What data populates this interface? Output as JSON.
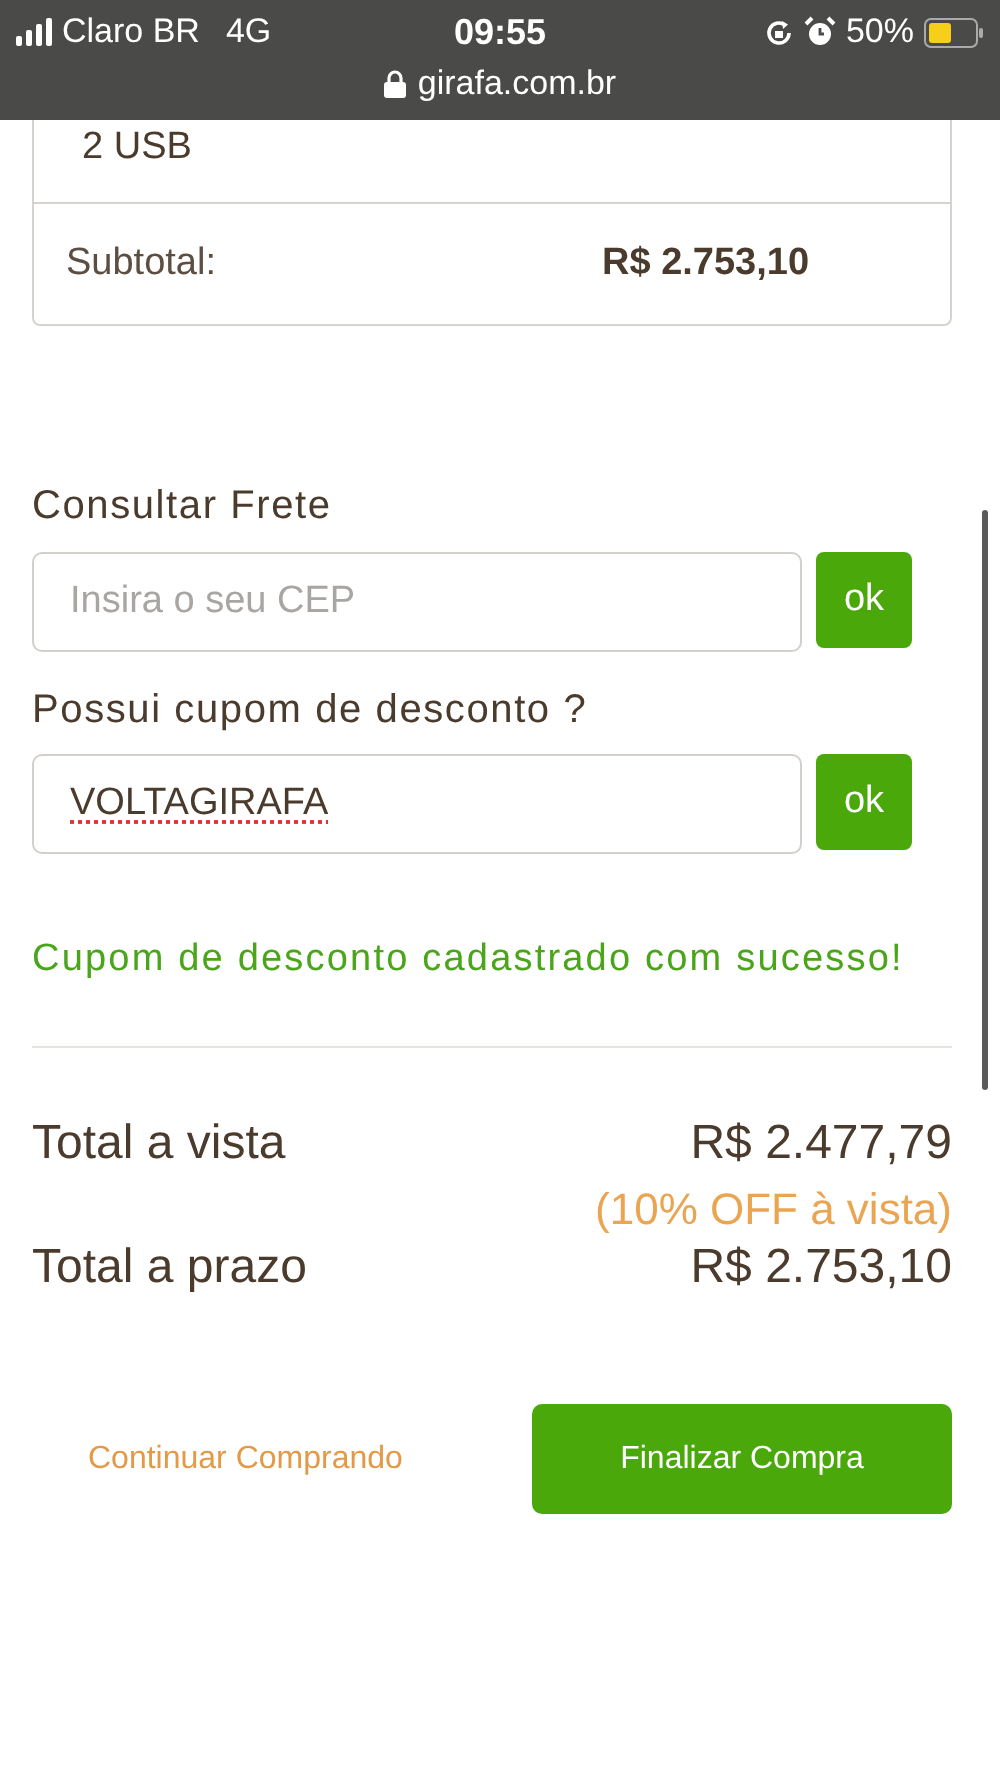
{
  "status_bar": {
    "carrier": "Claro BR",
    "network": "4G",
    "time": "09:55",
    "battery": "50%",
    "url": "girafa.com.br"
  },
  "order_card": {
    "item_line": "2 USB",
    "subtotal_label": "Subtotal:",
    "subtotal_value": "R$ 2.753,10"
  },
  "shipping": {
    "label": "Consultar Frete",
    "placeholder": "Insira o seu CEP",
    "button": "ok"
  },
  "coupon": {
    "label": "Possui cupom de desconto ?",
    "value": "VOLTAGIRAFA",
    "button": "ok",
    "message": "Cupom de desconto cadastrado com sucesso!"
  },
  "totals": [
    {
      "label": "Total a vista",
      "value": "R$ 2.477,79",
      "note": "(10% OFF à vista)"
    },
    {
      "label": "Total a prazo",
      "value": "R$ 2.753,10"
    }
  ],
  "actions": {
    "continue": "Continuar Comprando",
    "checkout": "Finalizar Compra"
  }
}
